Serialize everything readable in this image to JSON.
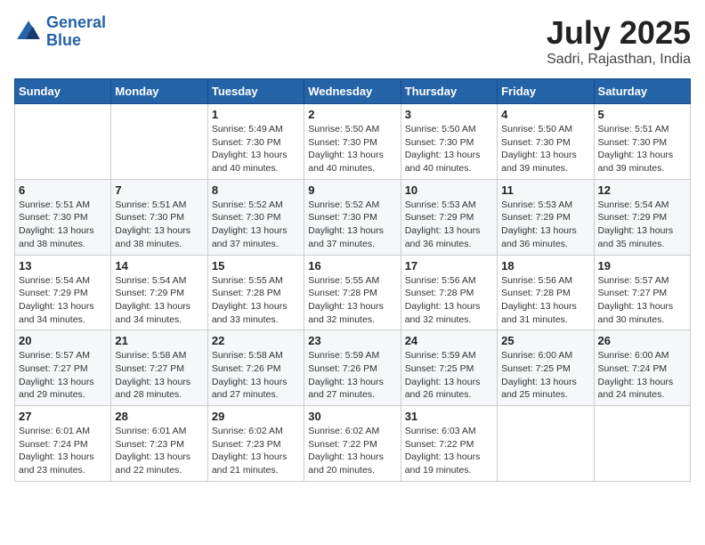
{
  "header": {
    "logo_line1": "General",
    "logo_line2": "Blue",
    "month": "July 2025",
    "location": "Sadri, Rajasthan, India"
  },
  "days_of_week": [
    "Sunday",
    "Monday",
    "Tuesday",
    "Wednesday",
    "Thursday",
    "Friday",
    "Saturday"
  ],
  "weeks": [
    [
      {
        "day": "",
        "info": ""
      },
      {
        "day": "",
        "info": ""
      },
      {
        "day": "1",
        "info": "Sunrise: 5:49 AM\nSunset: 7:30 PM\nDaylight: 13 hours and 40 minutes."
      },
      {
        "day": "2",
        "info": "Sunrise: 5:50 AM\nSunset: 7:30 PM\nDaylight: 13 hours and 40 minutes."
      },
      {
        "day": "3",
        "info": "Sunrise: 5:50 AM\nSunset: 7:30 PM\nDaylight: 13 hours and 40 minutes."
      },
      {
        "day": "4",
        "info": "Sunrise: 5:50 AM\nSunset: 7:30 PM\nDaylight: 13 hours and 39 minutes."
      },
      {
        "day": "5",
        "info": "Sunrise: 5:51 AM\nSunset: 7:30 PM\nDaylight: 13 hours and 39 minutes."
      }
    ],
    [
      {
        "day": "6",
        "info": "Sunrise: 5:51 AM\nSunset: 7:30 PM\nDaylight: 13 hours and 38 minutes."
      },
      {
        "day": "7",
        "info": "Sunrise: 5:51 AM\nSunset: 7:30 PM\nDaylight: 13 hours and 38 minutes."
      },
      {
        "day": "8",
        "info": "Sunrise: 5:52 AM\nSunset: 7:30 PM\nDaylight: 13 hours and 37 minutes."
      },
      {
        "day": "9",
        "info": "Sunrise: 5:52 AM\nSunset: 7:30 PM\nDaylight: 13 hours and 37 minutes."
      },
      {
        "day": "10",
        "info": "Sunrise: 5:53 AM\nSunset: 7:29 PM\nDaylight: 13 hours and 36 minutes."
      },
      {
        "day": "11",
        "info": "Sunrise: 5:53 AM\nSunset: 7:29 PM\nDaylight: 13 hours and 36 minutes."
      },
      {
        "day": "12",
        "info": "Sunrise: 5:54 AM\nSunset: 7:29 PM\nDaylight: 13 hours and 35 minutes."
      }
    ],
    [
      {
        "day": "13",
        "info": "Sunrise: 5:54 AM\nSunset: 7:29 PM\nDaylight: 13 hours and 34 minutes."
      },
      {
        "day": "14",
        "info": "Sunrise: 5:54 AM\nSunset: 7:29 PM\nDaylight: 13 hours and 34 minutes."
      },
      {
        "day": "15",
        "info": "Sunrise: 5:55 AM\nSunset: 7:28 PM\nDaylight: 13 hours and 33 minutes."
      },
      {
        "day": "16",
        "info": "Sunrise: 5:55 AM\nSunset: 7:28 PM\nDaylight: 13 hours and 32 minutes."
      },
      {
        "day": "17",
        "info": "Sunrise: 5:56 AM\nSunset: 7:28 PM\nDaylight: 13 hours and 32 minutes."
      },
      {
        "day": "18",
        "info": "Sunrise: 5:56 AM\nSunset: 7:28 PM\nDaylight: 13 hours and 31 minutes."
      },
      {
        "day": "19",
        "info": "Sunrise: 5:57 AM\nSunset: 7:27 PM\nDaylight: 13 hours and 30 minutes."
      }
    ],
    [
      {
        "day": "20",
        "info": "Sunrise: 5:57 AM\nSunset: 7:27 PM\nDaylight: 13 hours and 29 minutes."
      },
      {
        "day": "21",
        "info": "Sunrise: 5:58 AM\nSunset: 7:27 PM\nDaylight: 13 hours and 28 minutes."
      },
      {
        "day": "22",
        "info": "Sunrise: 5:58 AM\nSunset: 7:26 PM\nDaylight: 13 hours and 27 minutes."
      },
      {
        "day": "23",
        "info": "Sunrise: 5:59 AM\nSunset: 7:26 PM\nDaylight: 13 hours and 27 minutes."
      },
      {
        "day": "24",
        "info": "Sunrise: 5:59 AM\nSunset: 7:25 PM\nDaylight: 13 hours and 26 minutes."
      },
      {
        "day": "25",
        "info": "Sunrise: 6:00 AM\nSunset: 7:25 PM\nDaylight: 13 hours and 25 minutes."
      },
      {
        "day": "26",
        "info": "Sunrise: 6:00 AM\nSunset: 7:24 PM\nDaylight: 13 hours and 24 minutes."
      }
    ],
    [
      {
        "day": "27",
        "info": "Sunrise: 6:01 AM\nSunset: 7:24 PM\nDaylight: 13 hours and 23 minutes."
      },
      {
        "day": "28",
        "info": "Sunrise: 6:01 AM\nSunset: 7:23 PM\nDaylight: 13 hours and 22 minutes."
      },
      {
        "day": "29",
        "info": "Sunrise: 6:02 AM\nSunset: 7:23 PM\nDaylight: 13 hours and 21 minutes."
      },
      {
        "day": "30",
        "info": "Sunrise: 6:02 AM\nSunset: 7:22 PM\nDaylight: 13 hours and 20 minutes."
      },
      {
        "day": "31",
        "info": "Sunrise: 6:03 AM\nSunset: 7:22 PM\nDaylight: 13 hours and 19 minutes."
      },
      {
        "day": "",
        "info": ""
      },
      {
        "day": "",
        "info": ""
      }
    ]
  ]
}
